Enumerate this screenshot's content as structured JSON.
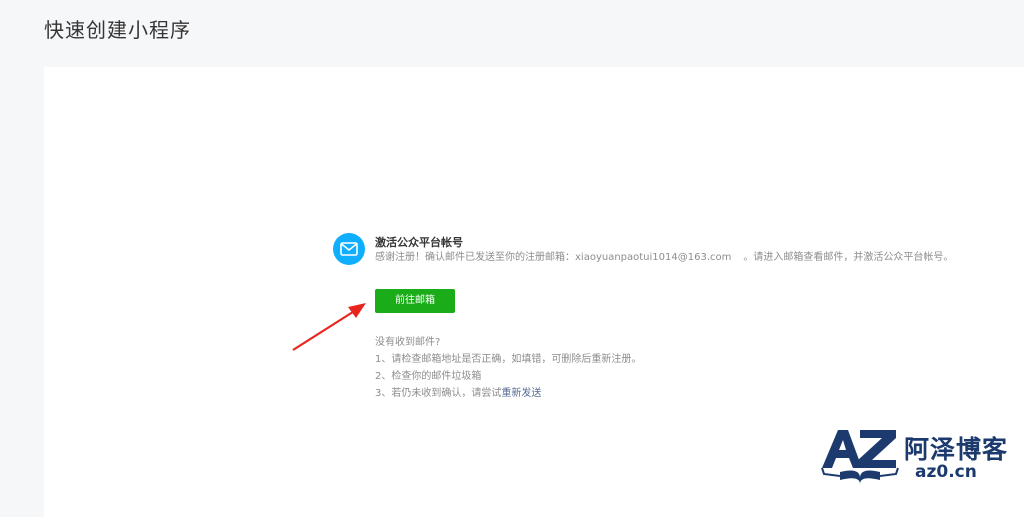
{
  "page": {
    "title": "快速创建小程序"
  },
  "notice": {
    "title": "激活公众平台帐号",
    "desc_prefix": "感谢注册！确认邮件已发送至你的注册邮箱：",
    "email": "xiaoyuanpaotui1014@163.com",
    "desc_suffix": "。请进入邮箱查看邮件，并激活公众平台帐号。",
    "button_label": "前往邮箱"
  },
  "help": {
    "heading": "没有收到邮件?",
    "item1": "1、请检查邮箱地址是否正确，如填错，可删除后重新注册。",
    "item2": "2、检查你的邮件垃圾箱",
    "item3_prefix": "3、若仍未收到确认，请尝试",
    "resend_link": "重新发送"
  },
  "watermark": {
    "logo_text": "AZ",
    "name": "阿泽博客",
    "url": "az0.cn"
  },
  "colors": {
    "primary_button": "#1aad19",
    "mail_icon_bg": "#10aeff",
    "link": "#576b95",
    "arrow": "#e8251c"
  },
  "icons": {
    "mail": "mail-icon",
    "arrow": "annotation-arrow"
  }
}
